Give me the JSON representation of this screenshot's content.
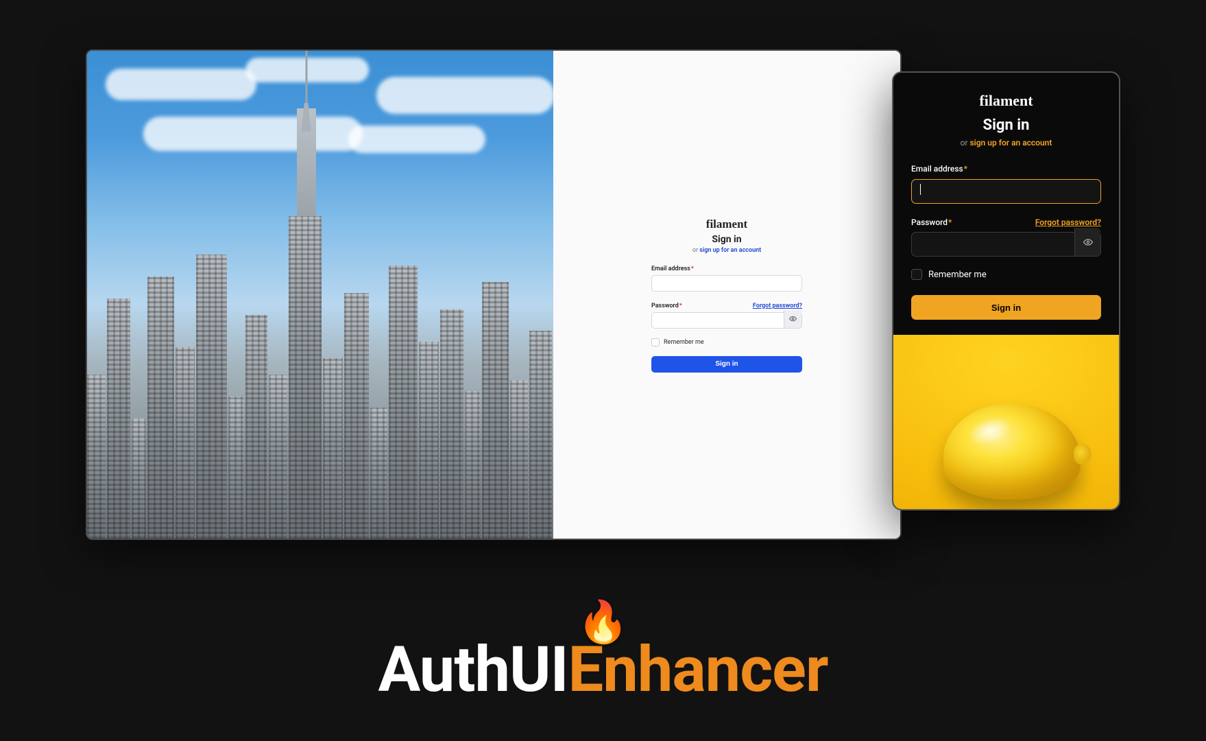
{
  "brand": "filament",
  "product": {
    "flame_glyph": "🔥",
    "name_part1": "AuthUI",
    "name_part2": "Enhancer"
  },
  "light": {
    "title": "Sign in",
    "sub_prefix": "or ",
    "signup_link": "sign up for an account",
    "email_label": "Email address",
    "password_label": "Password",
    "required_mark": "*",
    "forgot_link": "Forgot password?",
    "remember_label": "Remember me",
    "submit_label": "Sign in",
    "email_value": "",
    "password_value": ""
  },
  "dark": {
    "title": "Sign in",
    "sub_prefix": "or ",
    "signup_link": "sign up for an account",
    "email_label": "Email address",
    "password_label": "Password",
    "required_mark": "*",
    "forgot_link": "Forgot password?",
    "remember_label": "Remember me",
    "submit_label": "Sign in",
    "email_value": "",
    "password_value": ""
  }
}
